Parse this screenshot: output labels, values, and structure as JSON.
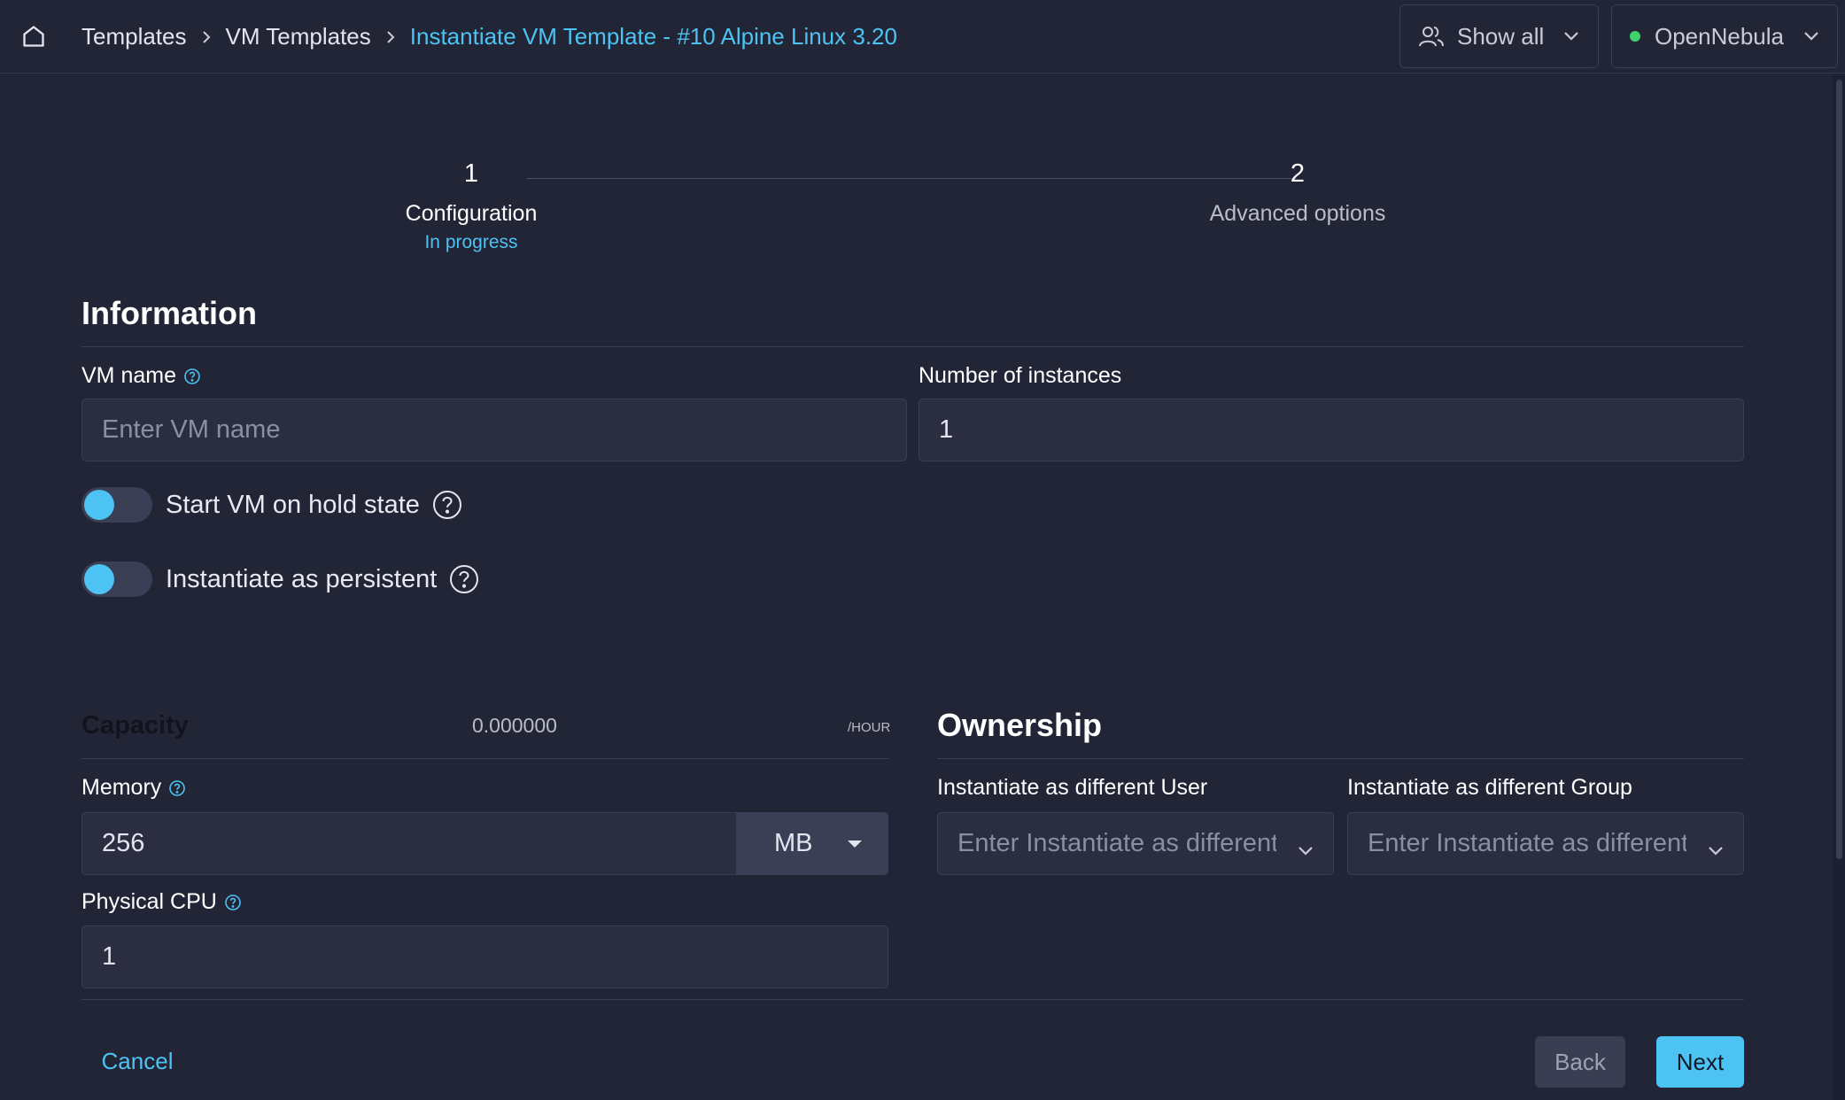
{
  "breadcrumb": {
    "items": [
      "Templates",
      "VM Templates"
    ],
    "current": "Instantiate VM Template - #10 Alpine Linux 3.20"
  },
  "header": {
    "group_filter_label": "Show all",
    "zone_label": "OpenNebula",
    "zone_status_color": "#3fd26d"
  },
  "stepper": {
    "steps": [
      {
        "number": "1",
        "title": "Configuration",
        "status": "In progress"
      },
      {
        "number": "2",
        "title": "Advanced options"
      }
    ]
  },
  "information": {
    "title": "Information",
    "vm_name_label": "VM name",
    "vm_name_placeholder": "Enter VM name",
    "instances_label": "Number of instances",
    "instances_value": "1",
    "hold_label": "Start VM on hold state",
    "persistent_label": "Instantiate as persistent"
  },
  "capacity": {
    "title": "Capacity",
    "cost": "0.000000",
    "cost_unit": "/HOUR",
    "memory_label": "Memory",
    "memory_value": "256",
    "memory_unit": "MB",
    "cpu_label": "Physical CPU",
    "cpu_value": "1"
  },
  "ownership": {
    "title": "Ownership",
    "user_label": "Instantiate as different User",
    "user_placeholder": "Enter Instantiate as different User",
    "group_label": "Instantiate as different Group",
    "group_placeholder": "Enter Instantiate as different Group"
  },
  "actions": {
    "cancel": "Cancel",
    "back": "Back",
    "next": "Next"
  },
  "theme": {
    "accent": "#4cc3f2",
    "background": "#222536"
  }
}
